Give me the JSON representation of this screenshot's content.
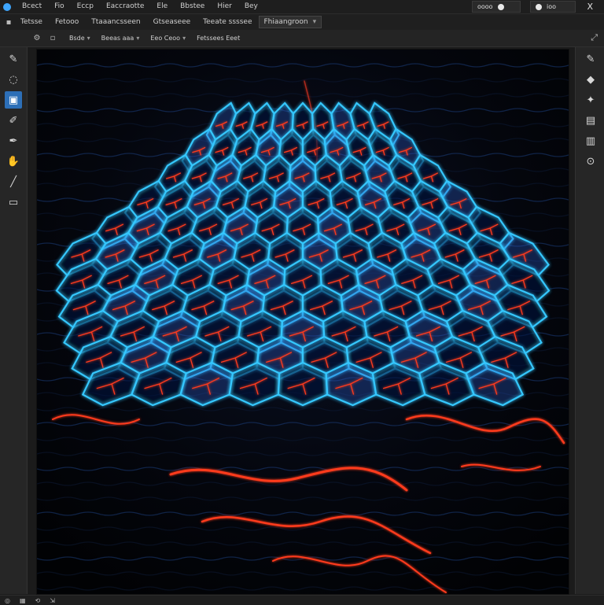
{
  "menubar": {
    "items": [
      "Bcect",
      "Fio",
      "Eccp",
      "Eaccraotte",
      "Ele",
      "Bbstee",
      "Hier",
      "Bey"
    ]
  },
  "submenu": {
    "items": [
      "Tetsse",
      "Fetooo",
      "Ttaaancsseen",
      "Gtseaseee",
      "Teeate ssssee"
    ],
    "active": "Fhiaangroon"
  },
  "window": {
    "search_label": "oooo",
    "account_label": "ioo",
    "close_glyph": "X"
  },
  "options": {
    "items": [
      "Bsde",
      "Beeas aaa",
      "Eeo Ceoo",
      "Fetssees Eeet"
    ]
  },
  "tools_left": [
    {
      "icon": "eraser-icon",
      "glyph": "✎"
    },
    {
      "icon": "lasso-icon",
      "glyph": "◌"
    },
    {
      "icon": "select-icon",
      "glyph": "▣"
    },
    {
      "icon": "brush-icon",
      "glyph": "✐"
    },
    {
      "icon": "pen-icon",
      "glyph": "✒"
    },
    {
      "icon": "hand-icon",
      "glyph": "✋"
    },
    {
      "icon": "stylus-icon",
      "glyph": "╱"
    },
    {
      "icon": "frame-icon",
      "glyph": "▭"
    }
  ],
  "tools_right": [
    {
      "icon": "pipette-icon",
      "glyph": "✎"
    },
    {
      "icon": "stamp-icon",
      "glyph": "◆"
    },
    {
      "icon": "wand-icon",
      "glyph": "✦"
    },
    {
      "icon": "layers-icon",
      "glyph": "▤"
    },
    {
      "icon": "adjust-icon",
      "glyph": "▥"
    },
    {
      "icon": "zoom-icon",
      "glyph": "⊙"
    }
  ],
  "colors": {
    "accent": "#2d6fb7",
    "neon_blue": "#35c8ff",
    "neon_red": "#ff3b1f"
  }
}
